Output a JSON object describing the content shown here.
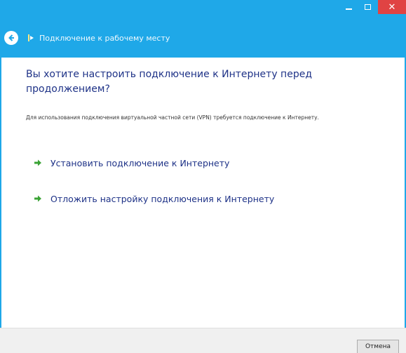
{
  "window": {
    "min_glyph": "",
    "close_glyph": "✕"
  },
  "nav": {
    "title": "Подключение к рабочему месту"
  },
  "main": {
    "heading": "Вы хотите настроить подключение к Интернету перед продолжением?",
    "description": "Для использования подключения виртуальной частной сети (VPN) требуется подключение к Интернету.",
    "options": [
      {
        "label": "Установить подключение к Интернету"
      },
      {
        "label": "Отложить настройку подключения к Интернету"
      }
    ]
  },
  "footer": {
    "cancel_label": "Отмена"
  },
  "colors": {
    "accent": "#1fa8e8",
    "close": "#e04343",
    "link": "#1e3287",
    "arrow": "#3aa335"
  }
}
